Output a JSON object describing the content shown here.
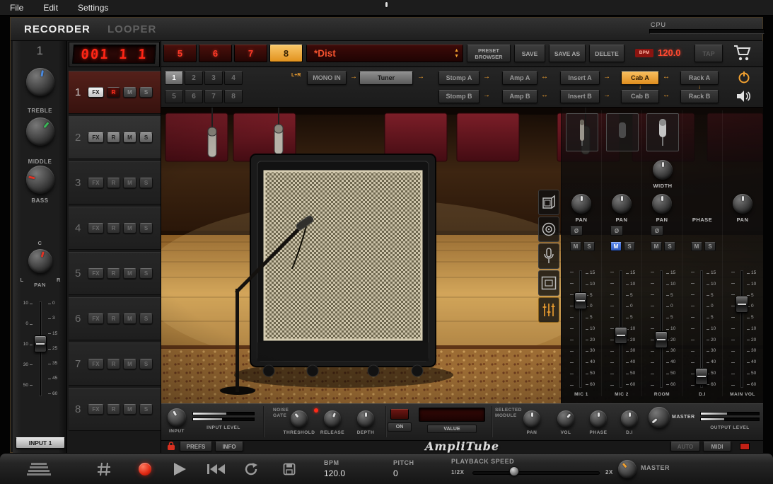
{
  "colors": {
    "accent": "#f0a030",
    "led_red": "#ff2a18",
    "phase_blue": "#3a6fd8"
  },
  "menubar": {
    "items": [
      {
        "label": "File"
      },
      {
        "label": "Edit"
      },
      {
        "label": "Settings"
      }
    ]
  },
  "header": {
    "recorder_tab": "RECORDER",
    "looper_tab": "LOOPER",
    "cpu_label": "CPU"
  },
  "symbols": {
    "arrow_right": "→",
    "arrow_both": "↔",
    "arrow_down": "↓",
    "phase": "Ø",
    "spin_up": "▲",
    "spin_down": "▼"
  },
  "channel_strip": {
    "number": "1",
    "treble_label": "TREBLE",
    "middle_label": "MIDDLE",
    "bass_label": "BASS",
    "pan": {
      "label": "PAN",
      "c": "C",
      "l": "L",
      "r": "R"
    },
    "fader_scale_left": [
      "10",
      "0",
      "10",
      "30",
      "50"
    ],
    "fader_scale_right": [
      "0",
      "3",
      "15",
      "25",
      "35",
      "45",
      "60"
    ],
    "input_button": "INPUT 1"
  },
  "counter": {
    "value": "001 1 1"
  },
  "tracks": {
    "button_labels": {
      "fx": "FX",
      "r": "R",
      "m": "M",
      "s": "S"
    },
    "rows": [
      {
        "number": "1"
      },
      {
        "number": "2"
      },
      {
        "number": "3"
      },
      {
        "number": "4"
      },
      {
        "number": "5"
      },
      {
        "number": "6"
      },
      {
        "number": "7"
      },
      {
        "number": "8"
      }
    ]
  },
  "preset_bar": {
    "slots": [
      "5",
      "6",
      "7",
      "8"
    ],
    "active_slot": "8",
    "preset_name": "*Dist",
    "browser_label": "PRESET BROWSER",
    "save_label": "SAVE",
    "save_as_label": "SAVE AS",
    "delete_label": "DELETE",
    "bpm_badge": "BPM",
    "bpm_value": "120.0",
    "tap_label": "TAP"
  },
  "chain": {
    "slots_a": [
      "1",
      "2",
      "3",
      "4"
    ],
    "slots_b": [
      "5",
      "6",
      "7",
      "8"
    ],
    "active_slot": "1",
    "lr_label": "L+R",
    "mono_in": "MONO IN",
    "tuner": "Tuner",
    "stomp_a": "Stomp A",
    "amp_a": "Amp A",
    "insert_a": "Insert A",
    "cab_a": "Cab A",
    "rack_a": "Rack A",
    "stomp_b": "Stomp B",
    "amp_b": "Amp B",
    "insert_b": "Insert B",
    "cab_b": "Cab B",
    "rack_b": "Rack B"
  },
  "mixer": {
    "width_label": "WIDTH",
    "knob_labels": [
      "PAN",
      "PAN",
      "PAN",
      "PHASE",
      "PAN"
    ],
    "mute": "M",
    "solo": "S",
    "channel_labels": [
      "MIC 1",
      "MIC 2",
      "ROOM",
      "D.I",
      "MAIN VOL"
    ],
    "fader_scale": [
      "15",
      "10",
      "5",
      "0",
      "5",
      "10",
      "20",
      "30",
      "40",
      "50",
      "60"
    ]
  },
  "control_bar": {
    "input_label": "INPUT",
    "input_level_label": "INPUT  LEVEL",
    "noise_label": "NOISE",
    "gate_label": "GATE",
    "threshold_label": "THRESHOLD",
    "release_label": "RELEASE",
    "depth_label": "DEPTH",
    "on_label": "ON",
    "value_label": "VALUE",
    "selected_label": "SELECTED",
    "module_label": "MODULE",
    "pan_label": "PAN",
    "vol_label": "VOL",
    "phase_label": "PHASE",
    "di_label": "D.I",
    "master_label": "MASTER",
    "output_level_label": "OUTPUT  LEVEL"
  },
  "logo_bar": {
    "prefs": "PREFS",
    "info": "INFO",
    "logo": "AmpliTube",
    "auto": "AUTO",
    "midi": "MIDI"
  },
  "transport": {
    "bpm_label": "BPM",
    "bpm_value": "120.0",
    "pitch_label": "PITCH",
    "pitch_value": "0",
    "speed_label": "PLAYBACK SPEED",
    "speed_min": "1/2X",
    "speed_max": "2X",
    "master_label": "MASTER"
  }
}
